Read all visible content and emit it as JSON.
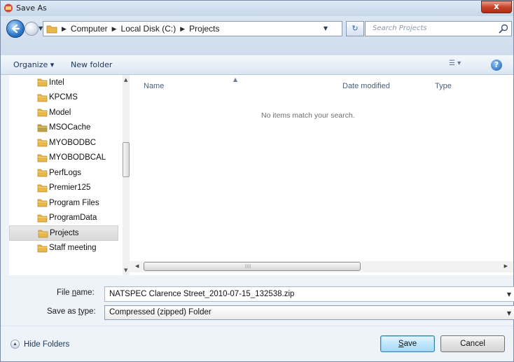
{
  "window": {
    "title": "Save As",
    "close_glyph": "x"
  },
  "address": {
    "breadcrumbs": [
      "Computer",
      "Local Disk (C:)",
      "Projects"
    ],
    "search_placeholder": "Search Projects"
  },
  "toolbar": {
    "organize": "Organize ▾",
    "new_folder": "New folder"
  },
  "nav": {
    "items": [
      {
        "label": "Intel"
      },
      {
        "label": "KPCMS"
      },
      {
        "label": "Model"
      },
      {
        "label": "MSOCache"
      },
      {
        "label": "MYOBODBC"
      },
      {
        "label": "MYOBODBCAL"
      },
      {
        "label": "PerfLogs"
      },
      {
        "label": "Premier125"
      },
      {
        "label": "Program Files"
      },
      {
        "label": "ProgramData"
      },
      {
        "label": "Projects"
      },
      {
        "label": "Staff meeting"
      }
    ],
    "selected": "Projects"
  },
  "filelist": {
    "columns": [
      "Name",
      "Date modified",
      "Type"
    ],
    "empty_message": "No items match your search."
  },
  "form": {
    "file_name_label": "File name:",
    "file_name_value": "NATSPEC Clarence Street_2010-07-15_132538.zip",
    "save_type_label": "Save as type:",
    "save_type_value": "Compressed (zipped) Folder"
  },
  "footer": {
    "hide_folders": "Hide Folders",
    "save": "Save",
    "cancel": "Cancel"
  },
  "colors": {
    "accent": "#3c7fb1",
    "folder": "#e8b84a",
    "window_frame": "#7a8ea8"
  }
}
